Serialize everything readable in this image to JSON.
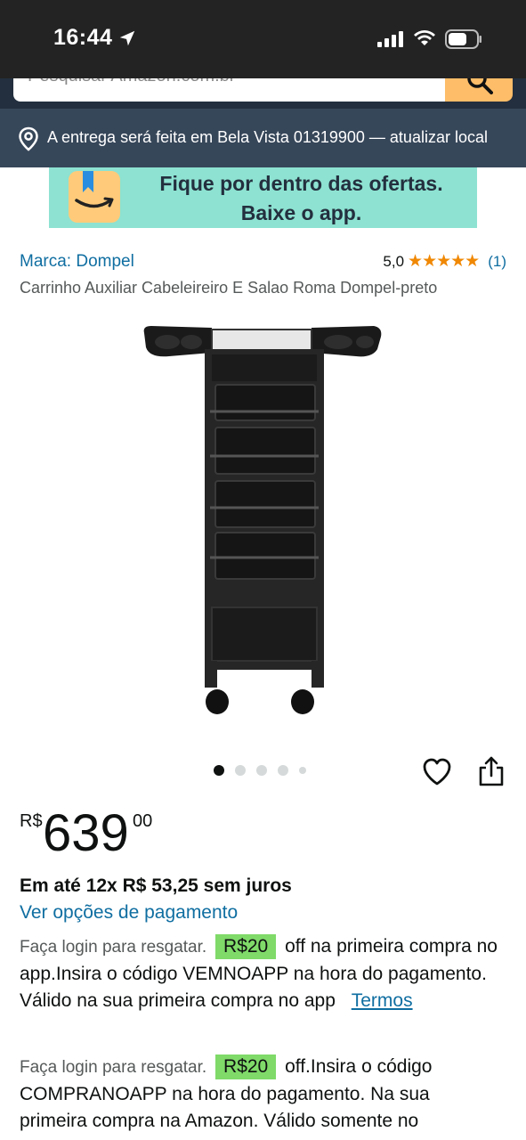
{
  "status_bar": {
    "time": "16:44"
  },
  "search": {
    "placeholder": "Pesquisar Amazon.com.br"
  },
  "delivery": {
    "text": "A entrega será feita em Bela Vista 01319900 — atualizar local"
  },
  "banner": {
    "text_line1": "Fique por dentro das ofertas.",
    "text_line2": "Baixe o app."
  },
  "product": {
    "brand": "Marca: Dompel",
    "rating_value": "5,0",
    "stars": "★★★★★",
    "rating_count": "(1)",
    "title": "Carrinho Auxiliar Cabeleireiro E Salao Roma Dompel-preto",
    "image_icon": "salon-trolley-image"
  },
  "carousel": {
    "total_images": 5,
    "active_index": 0
  },
  "price": {
    "currency": "R$",
    "whole": "639",
    "cents": "00",
    "installments": "Em até 12x R$ 53,25 sem juros",
    "payment_options_link": "Ver opções de pagamento"
  },
  "coupons": [
    {
      "login_text": "Faça login para resgatar.",
      "badge": "R$20",
      "text": "off na primeira compra no app.Insira o código VEMNOAPP na hora do pagamento. Válido na sua primeira compra no app",
      "terms_link": "Termos"
    },
    {
      "login_text": "Faça login para resgatar.",
      "badge": "R$20",
      "text": "off.Insira o código COMPRANOAPP na hora do pagamento. Na sua primeira compra na Amazon. Válido somente no"
    }
  ],
  "colors": {
    "status_bar_bg": "#232323",
    "header_bg": "#232f3e",
    "delivery_bg": "#37475a",
    "banner_bg": "#8de2d1",
    "link": "#0f6ea1",
    "star": "#f08804",
    "coupon_badge": "#7fda69",
    "search_button": "#febd69"
  }
}
